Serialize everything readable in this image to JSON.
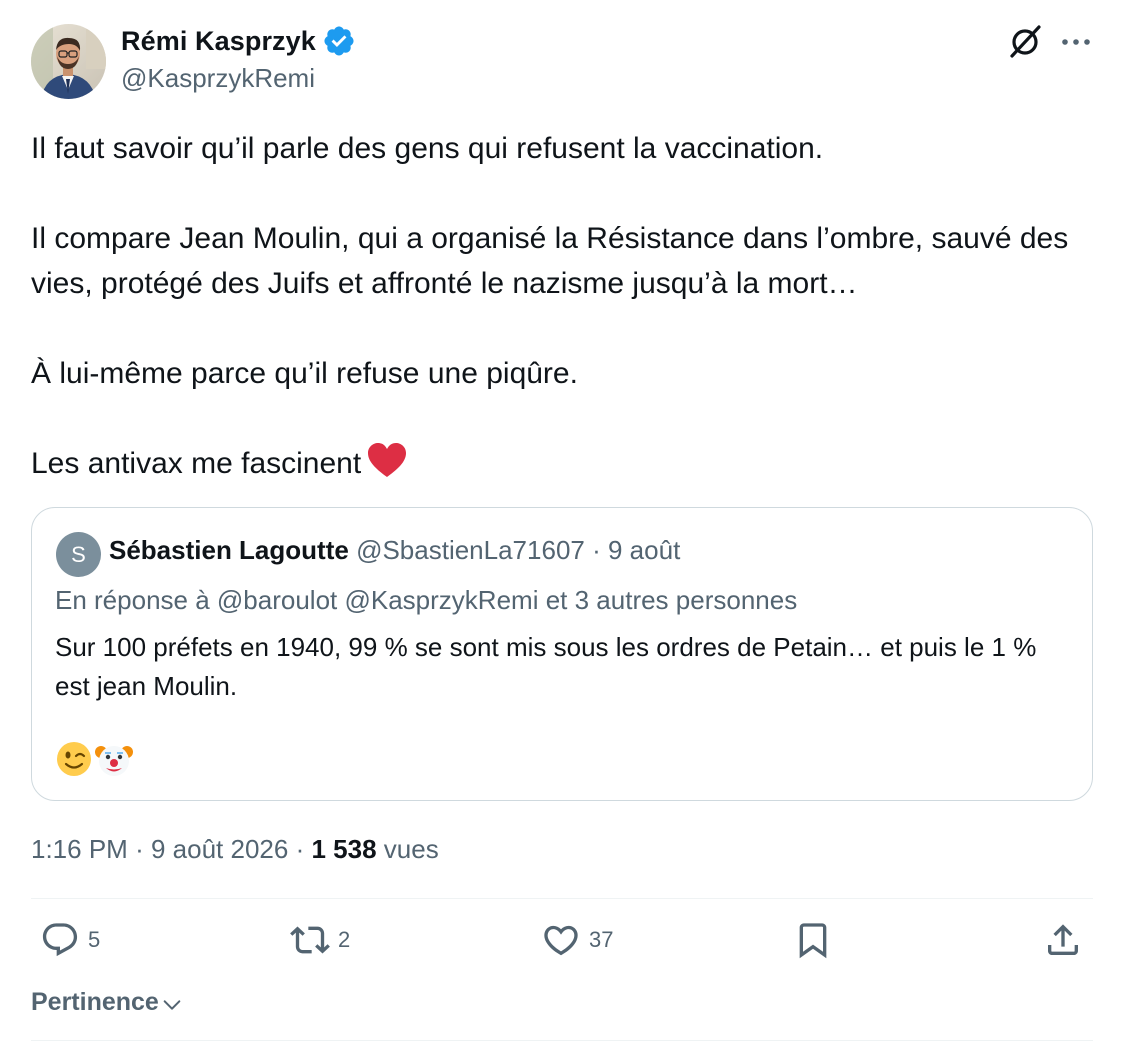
{
  "author": {
    "name": "Rémi Kasprzyk",
    "handle": "@KasprzykRemi"
  },
  "tweet": {
    "paragraphs": [
      "Il faut savoir qu’il parle des gens qui refusent la vaccination.",
      "Il compare Jean Moulin, qui a organisé la Résistance dans l’ombre, sauvé des vies, protégé des Juifs et affronté le nazisme jusqu’à la mort…",
      "À lui-même parce qu’il refuse une piqûre.",
      "Les antivax me fascinent"
    ]
  },
  "quote": {
    "avatar_letter": "S",
    "name": "Sébastien Lagoutte",
    "handle": "@SbastienLa71607",
    "separator": "·",
    "date": "9 août",
    "reply_prefix": "En réponse à",
    "reply_mentions": "@baroulot @KasprzykRemi",
    "reply_suffix": "et 3 autres personnes",
    "text": "Sur 100 préfets en 1940, 99 % se sont mis sous les ordres de Petain… et puis le 1 % est jean Moulin."
  },
  "meta": {
    "time": "1:16 PM",
    "date": "9 août 2026",
    "separator": "·",
    "views_count": "1 538",
    "views_label": "vues"
  },
  "actions": {
    "replies": "5",
    "reposts": "2",
    "likes": "37"
  },
  "sort": {
    "label": "Pertinence"
  },
  "icons": {
    "verified": "verified-badge-icon",
    "grok": "grok-icon",
    "more": "more-icon",
    "heart_emoji": "red-heart-emoji",
    "wink_emoji": "winking-face-emoji",
    "clown_emoji": "clown-face-emoji",
    "reply": "reply-icon",
    "repost": "repost-icon",
    "like": "like-icon",
    "bookmark": "bookmark-icon",
    "share": "share-icon",
    "chevron": "chevron-down-icon"
  },
  "colors": {
    "verified": "#1d9bf0",
    "text": "#0f1419",
    "secondary": "#536471",
    "heart": "#dd2e44"
  }
}
